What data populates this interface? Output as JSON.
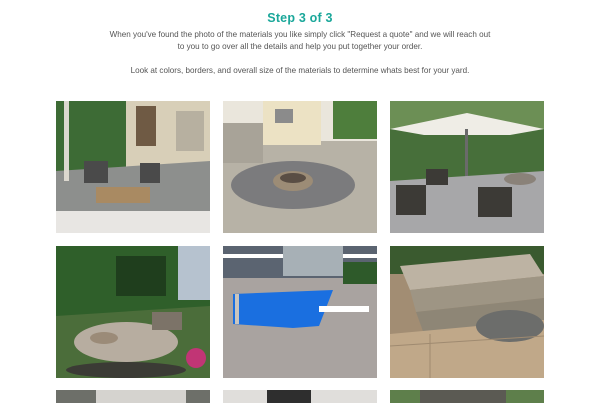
{
  "header": {
    "step_title": "Step 3 of 3",
    "instructions_line1": "When you've found the photo of the materials you like simply click \"Request a quote\" and we will reach out",
    "instructions_line2": "to you to go over all the details and help you put together your order.",
    "note": "Look at colors, borders, and overall size of the materials to determine whats best for your yard."
  },
  "gallery": {
    "photos": [
      {
        "subject": "patio-with-couches"
      },
      {
        "subject": "circular-patio-with-firepit"
      },
      {
        "subject": "patio-with-umbrella"
      },
      {
        "subject": "garden-patio-with-firepit"
      },
      {
        "subject": "pool-with-diving-board"
      },
      {
        "subject": "stone-steps"
      }
    ]
  },
  "colors": {
    "accent": "#1aa79a",
    "body_text": "#555555"
  }
}
